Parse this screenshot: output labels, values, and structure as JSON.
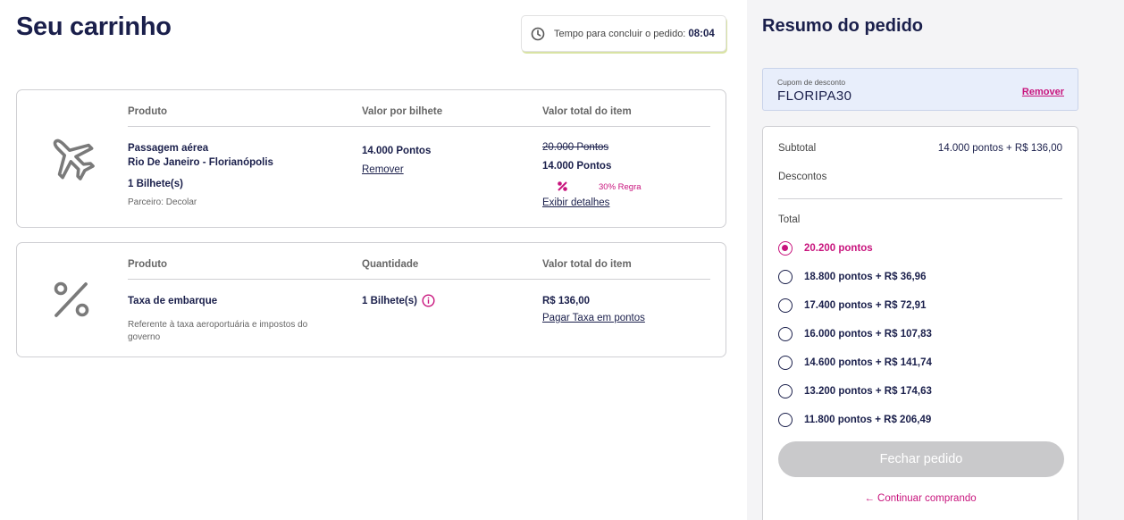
{
  "cart": {
    "title": "Seu carrinho",
    "timer": {
      "label": "Tempo para concluir o pedido:",
      "value": "08:04",
      "icon": "clock-icon"
    },
    "items": [
      {
        "icon": "airplane-icon",
        "headers": [
          "Produto",
          "Valor por bilhete",
          "Valor total do item"
        ],
        "product_name": "Passagem aérea",
        "route": "Rio De Janeiro - Florianópolis",
        "quantity": "1 Bilhete(s)",
        "partner": "Parceiro: Decolar",
        "unit_value": "14.000 Pontos",
        "remove_label": "Remover",
        "old_total": "20.000 Pontos",
        "total": "14.000 Pontos",
        "rule_label": "30% Regra",
        "details_label": "Exibir detalhes"
      },
      {
        "icon": "percent-icon",
        "headers": [
          "Produto",
          "Quantidade",
          "Valor total do item"
        ],
        "product_name": "Taxa de embarque",
        "description": "Referente à taxa aeroportuária e impostos do governo",
        "quantity": "1 Bilhete(s)",
        "total": "R$ 136,00",
        "pay_points_label": "Pagar Taxa em pontos"
      }
    ]
  },
  "summary": {
    "title": "Resumo do pedido",
    "coupon": {
      "label": "Cupom de desconto",
      "code": "FLORIPA30",
      "remove_label": "Remover"
    },
    "subtotal_label": "Subtotal",
    "subtotal_value": "14.000 pontos + R$ 136,00",
    "discounts_label": "Descontos",
    "total_label": "Total",
    "options": [
      {
        "label": "20.200 pontos",
        "selected": true
      },
      {
        "label": "18.800 pontos + R$ 36,96",
        "selected": false
      },
      {
        "label": "17.400 pontos + R$ 72,91",
        "selected": false
      },
      {
        "label": "16.000 pontos + R$ 107,83",
        "selected": false
      },
      {
        "label": "14.600 pontos + R$ 141,74",
        "selected": false
      },
      {
        "label": "13.200 pontos + R$ 174,63",
        "selected": false
      },
      {
        "label": "11.800 pontos + R$ 206,49",
        "selected": false
      }
    ],
    "checkout_label": "Fechar pedido",
    "continue_label": "Continuar comprando",
    "colors": {
      "accent": "#c8147d",
      "navy": "#1a1f4b",
      "disabled": "#c9c9cb"
    }
  }
}
